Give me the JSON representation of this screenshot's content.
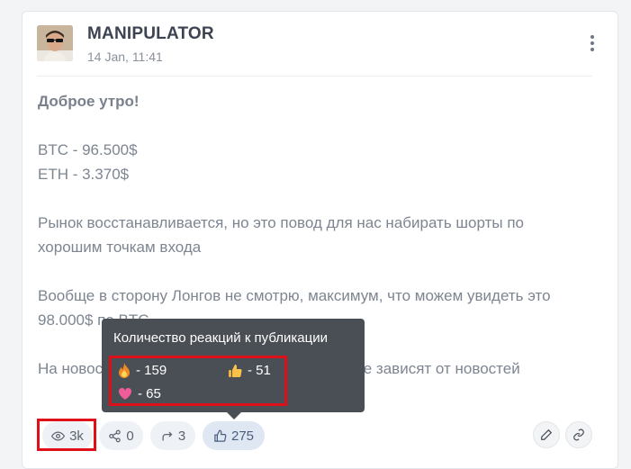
{
  "post": {
    "author": "MANIPULATOR",
    "date": "14 Jan, 11:41",
    "greeting": "Доброе утро!",
    "btc": "BTC - 96.500$",
    "eth": "ETH - 3.370$",
    "para1": "Рынок восстанавливается, но это повод для нас набирать шорты по хорошим точкам входа",
    "para2": "Вообще в сторону Лонгов не смотрю, максимум, что можем увидеть это 98.000$ по BTC",
    "para3": "На новостях наших прокторах манипуляции не зависят от новостей"
  },
  "actions": {
    "views": "3k",
    "shares": "0",
    "reposts": "3",
    "likes": "275"
  },
  "tooltip": {
    "title": "Количество реакций к публикации",
    "fire": "- 159",
    "thumb": "- 51",
    "heart": "- 65"
  },
  "colors": {
    "highlight": "#e0101b",
    "tooltip_bg": "#4a4e55",
    "text": "#7d8591"
  },
  "icons": [
    "avatar",
    "more-vertical-icon",
    "eye-icon",
    "share-icon",
    "repost-icon",
    "thumbs-up-icon",
    "pencil-icon",
    "link-icon",
    "fire-icon",
    "heart-icon"
  ]
}
